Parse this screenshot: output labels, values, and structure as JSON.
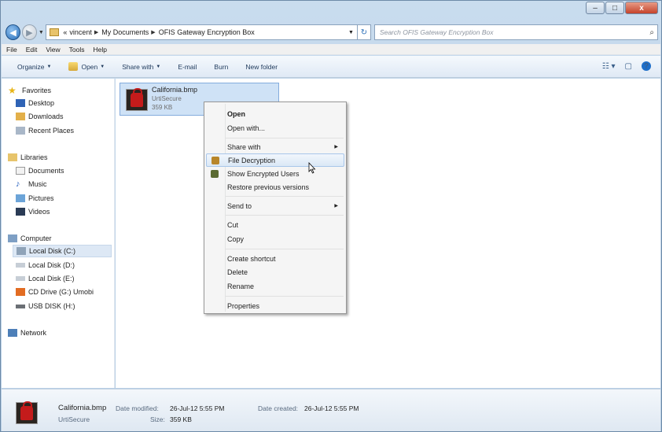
{
  "titlebar": {
    "buttons": {
      "minimize": "–",
      "maximize": "□",
      "close": "x"
    }
  },
  "nav": {
    "breadcrumb": [
      "«",
      "vincent",
      "My Documents",
      "OFIS Gateway Encryption Box"
    ],
    "search_placeholder": "Search OFIS Gateway Encryption Box"
  },
  "menubar": [
    "File",
    "Edit",
    "View",
    "Tools",
    "Help"
  ],
  "toolbar": {
    "organize": "Organize",
    "open": "Open",
    "share": "Share with",
    "email": "E-mail",
    "burn": "Burn",
    "new_folder": "New folder"
  },
  "sidebar": {
    "favorites": "Favorites",
    "fav_items": [
      "Desktop",
      "Downloads",
      "Recent Places"
    ],
    "libraries": "Libraries",
    "lib_items": [
      "Documents",
      "Music",
      "Pictures",
      "Videos"
    ],
    "computer": "Computer",
    "comp_items": [
      "Local Disk (C:)",
      "Local Disk (D:)",
      "Local Disk (E:)",
      "CD Drive (G:) Umobi",
      "USB DISK (H:)"
    ],
    "network": "Network"
  },
  "file": {
    "name": "California.bmp",
    "type": "UrtiSecure",
    "size": "359 KB"
  },
  "context_menu": {
    "open": "Open",
    "open_with": "Open with...",
    "share_with": "Share with",
    "file_decryption": "File Decryption",
    "show_encrypted": "Show Encrypted Users",
    "restore": "Restore previous versions",
    "send_to": "Send to",
    "cut": "Cut",
    "copy": "Copy",
    "create_shortcut": "Create shortcut",
    "delete": "Delete",
    "rename": "Rename",
    "properties": "Properties"
  },
  "details": {
    "name": "California.bmp",
    "type": "UrtiSecure",
    "date_modified_label": "Date modified:",
    "date_modified": "26-Jul-12 5:55 PM",
    "date_created_label": "Date created:",
    "date_created": "26-Jul-12 5:55 PM",
    "size_label": "Size:",
    "size": "359 KB"
  }
}
